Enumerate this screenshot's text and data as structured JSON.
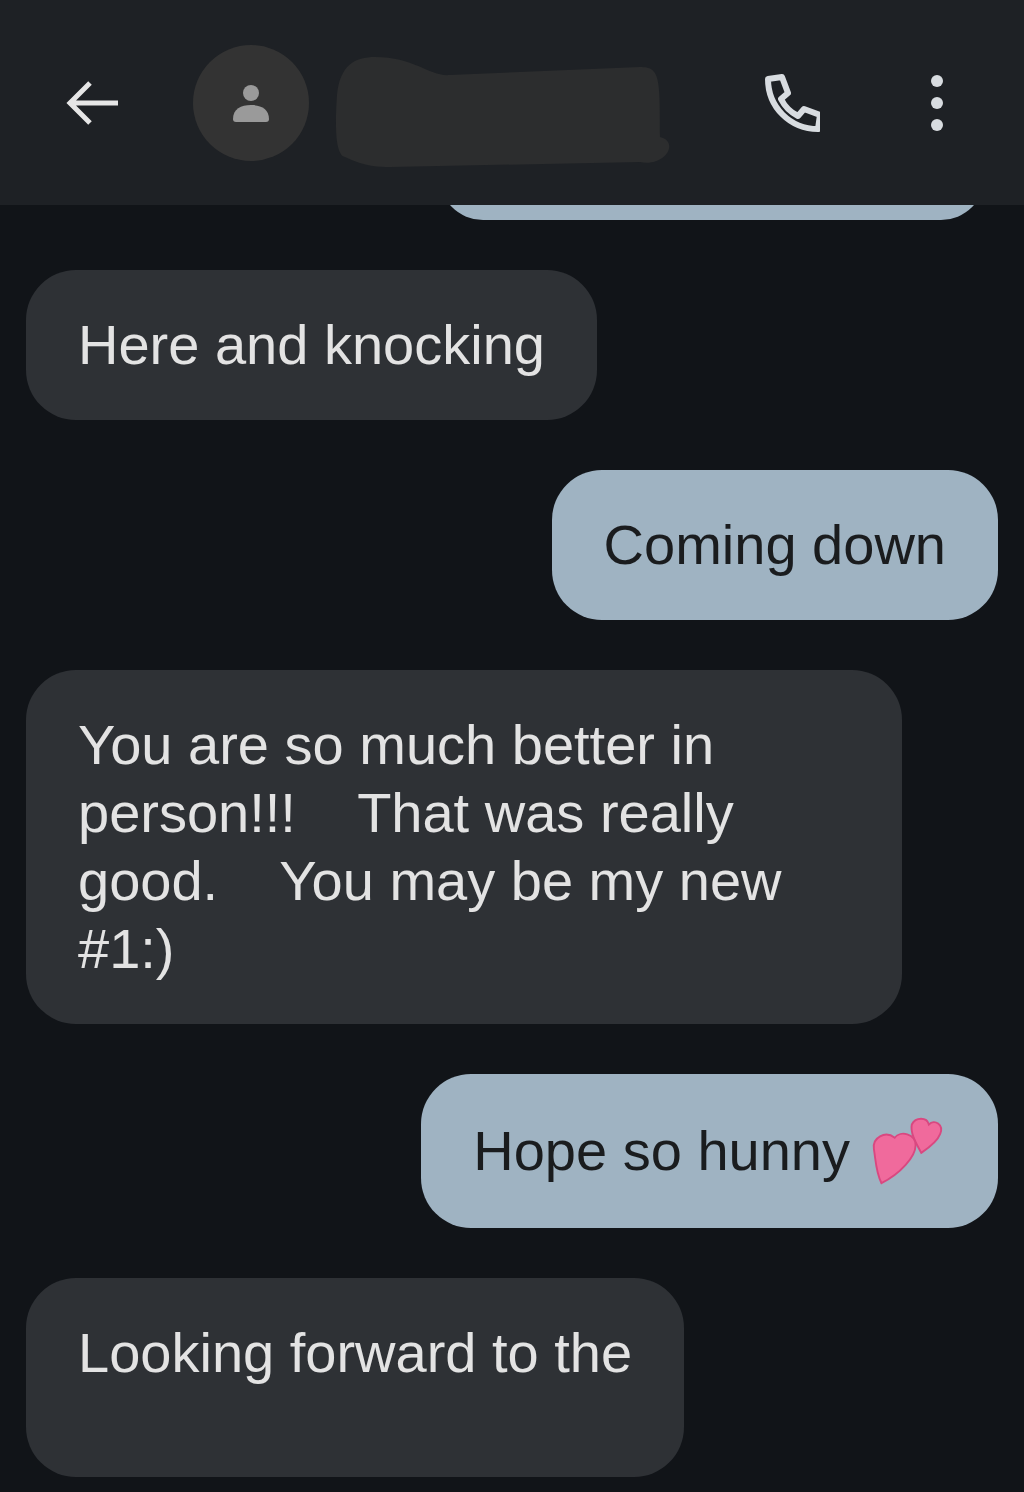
{
  "messages": [
    {
      "kind": "received",
      "text": "Here and knocking"
    },
    {
      "kind": "sent",
      "text": "Coming down"
    },
    {
      "kind": "received",
      "text": "You are so much better in person!!!    That was really good.    You may be my new #1:)"
    },
    {
      "kind": "sent",
      "text": "Hope so hunny",
      "with_hearts": true
    },
    {
      "kind": "received",
      "text": "Looking forward to the"
    }
  ]
}
